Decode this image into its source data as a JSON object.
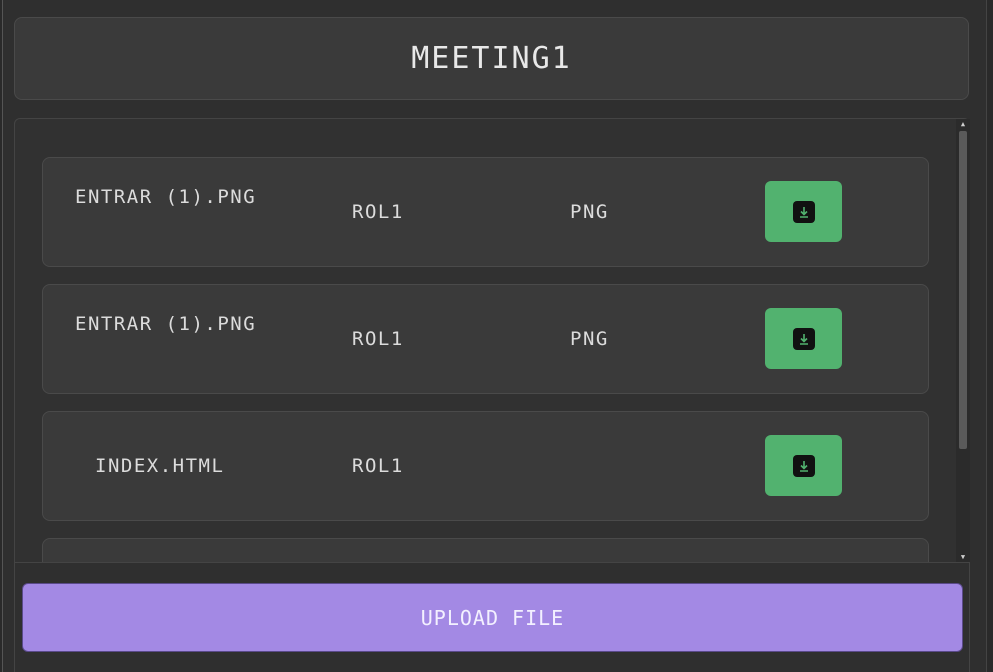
{
  "header": {
    "title": "MEETING1"
  },
  "files": [
    {
      "name": "ENTRAR (1).PNG",
      "owner": "ROL1",
      "type": "PNG"
    },
    {
      "name": "ENTRAR (1).PNG",
      "owner": "ROL1",
      "type": "PNG"
    },
    {
      "name": "INDEX.HTML",
      "owner": "ROL1",
      "type": ""
    }
  ],
  "actions": {
    "download_icon": "download-icon",
    "upload_label": "UPLOAD FILE"
  },
  "colors": {
    "download": "#52b26f",
    "upload": "#a389e4",
    "background": "#2f2f2f"
  }
}
